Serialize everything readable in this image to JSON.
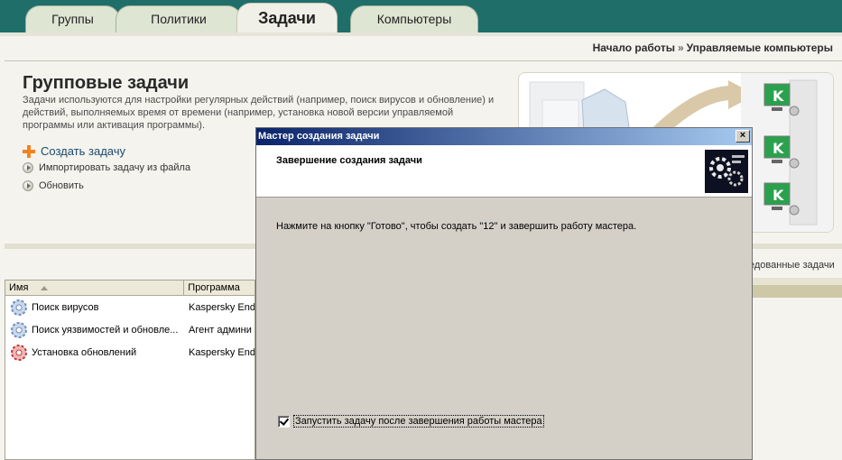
{
  "tabs": [
    {
      "label": "Группы",
      "active": false
    },
    {
      "label": "Политики",
      "active": false
    },
    {
      "label": "Задачи",
      "active": true
    },
    {
      "label": "Компьютеры",
      "active": false
    }
  ],
  "breadcrumb": {
    "home": "Начало работы",
    "separator": "»",
    "current": "Управляемые компьютеры"
  },
  "main": {
    "title": "Групповые задачи",
    "description": "Задачи используются для настройки регулярных действий (например, поиск вирусов и обновление) и действий, выполняемых время от времени (например, установка новой версии управляемой программы или активация программы).",
    "actions": {
      "create": "Создать задачу",
      "import": "Импортировать задачу из файла",
      "refresh": "Обновить"
    },
    "scheduled_label": "едованные задачи"
  },
  "table": {
    "columns": [
      "Имя",
      "Программа"
    ],
    "rows": [
      {
        "name": "Поиск вирусов",
        "program": "Kaspersky End",
        "icon": "gear-blue-icon"
      },
      {
        "name": "Поиск уязвимостей и обновле...",
        "program": "Агент админи",
        "icon": "gear-blue-icon"
      },
      {
        "name": "Установка обновлений",
        "program": "Kaspersky End",
        "icon": "gear-red-icon"
      }
    ]
  },
  "dialog": {
    "title": "Мастер создания задачи",
    "close": "×",
    "header": "Завершение создания задачи",
    "message": "Нажмите на кнопку \"Готово\", чтобы создать \"12\" и завершить работу мастера.",
    "checkbox_label": "Запустить задачу после завершения работы мастера",
    "checkbox_checked": true
  },
  "colors": {
    "tabbar": "#1f6e6a",
    "accent": "#f2831f",
    "dialog_title": "#0a246a"
  }
}
